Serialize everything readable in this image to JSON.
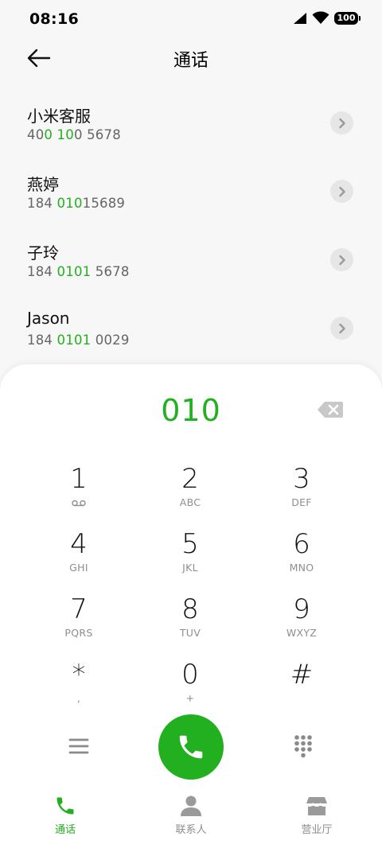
{
  "status_bar": {
    "time": "08:16",
    "battery": "100",
    "signal_icon": "signal-icon",
    "wifi_icon": "wifi-icon"
  },
  "header": {
    "title": "通话",
    "back_icon": "back-arrow-icon"
  },
  "contacts": [
    {
      "name": "小米客服",
      "number_parts": [
        "40",
        "0 10",
        "0 5678"
      ]
    },
    {
      "name": "燕婷",
      "number_parts": [
        "184 ",
        "010",
        "15689"
      ]
    },
    {
      "name": "子玲",
      "number_parts": [
        "184 ",
        "0101",
        " 5678"
      ]
    },
    {
      "name": "Jason",
      "number_parts": [
        "184 ",
        "0101",
        " 0029"
      ]
    }
  ],
  "dialpad": {
    "input": "010",
    "keys": [
      {
        "digit": "1",
        "letters": ""
      },
      {
        "digit": "2",
        "letters": "ABC"
      },
      {
        "digit": "3",
        "letters": "DEF"
      },
      {
        "digit": "4",
        "letters": "GHI"
      },
      {
        "digit": "5",
        "letters": "JKL"
      },
      {
        "digit": "6",
        "letters": "MNO"
      },
      {
        "digit": "7",
        "letters": "PQRS"
      },
      {
        "digit": "8",
        "letters": "TUV"
      },
      {
        "digit": "9",
        "letters": "WXYZ"
      },
      {
        "digit": "*",
        "letters": ","
      },
      {
        "digit": "0",
        "letters": "+"
      },
      {
        "digit": "#",
        "letters": ""
      }
    ]
  },
  "bottom_nav": {
    "items": [
      {
        "label": "通话",
        "icon": "phone-icon",
        "active": true
      },
      {
        "label": "联系人",
        "icon": "person-icon",
        "active": false
      },
      {
        "label": "营业厅",
        "icon": "store-icon",
        "active": false
      }
    ]
  },
  "colors": {
    "accent": "#23b020",
    "background": "#f7f7f7",
    "sheet": "#ffffff",
    "secondary_text": "#8e8e8e"
  }
}
